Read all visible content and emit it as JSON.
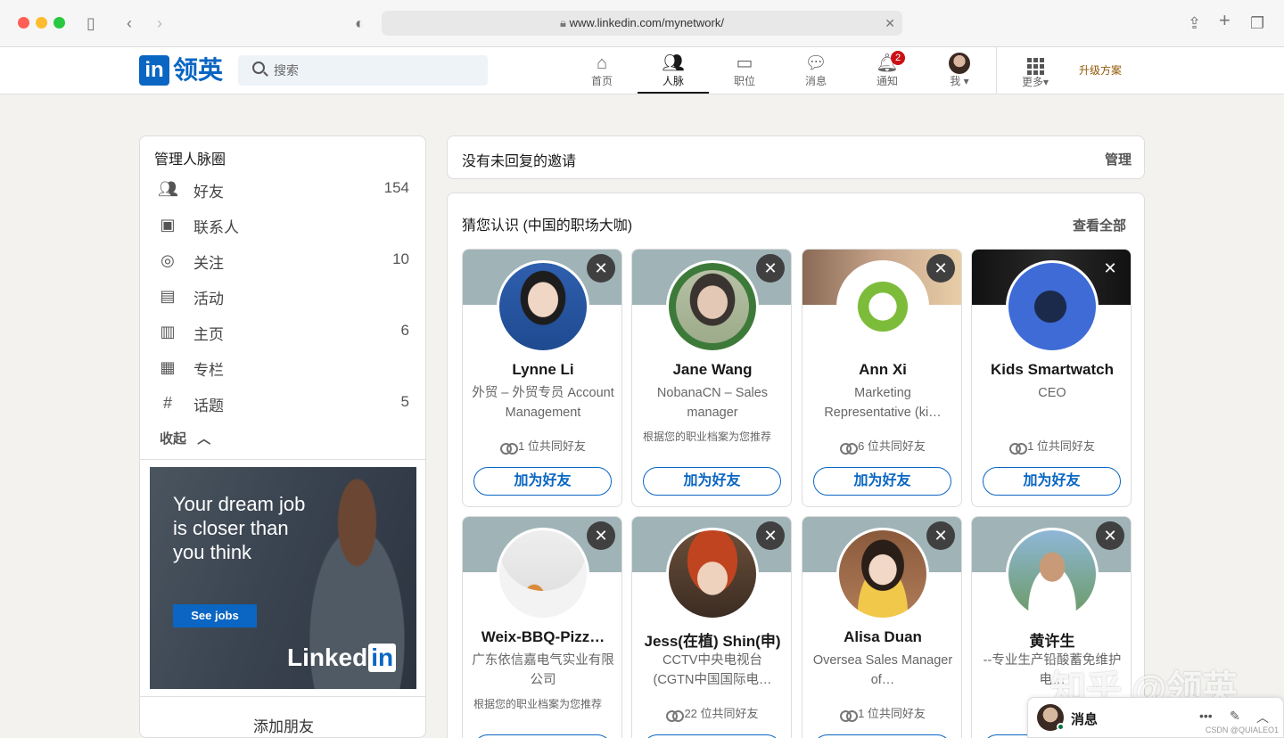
{
  "browser": {
    "url": "www.linkedin.com/mynetwork/"
  },
  "header": {
    "logo_in": "in",
    "logo_cn": "领英",
    "search_placeholder": "搜索",
    "nav": [
      {
        "label": "首页",
        "icon": "home-icon"
      },
      {
        "label": "人脉",
        "icon": "people-icon",
        "active": true
      },
      {
        "label": "职位",
        "icon": "briefcase-icon"
      },
      {
        "label": "消息",
        "icon": "messaging-icon"
      },
      {
        "label": "通知",
        "icon": "bell-icon",
        "badge": "2"
      },
      {
        "label": "我",
        "icon": "avatar"
      },
      {
        "label": "更多",
        "icon": "grid-icon"
      }
    ],
    "upgrade": "升级方案"
  },
  "sidebar": {
    "title": "管理人脉圈",
    "items": [
      {
        "label": "好友",
        "count": "154",
        "icon": "people-icon"
      },
      {
        "label": "联系人",
        "count": "",
        "icon": "contact-book-icon"
      },
      {
        "label": "关注",
        "count": "10",
        "icon": "follow-icon"
      },
      {
        "label": "活动",
        "count": "",
        "icon": "calendar-icon"
      },
      {
        "label": "主页",
        "count": "6",
        "icon": "building-icon"
      },
      {
        "label": "专栏",
        "count": "",
        "icon": "newsletter-icon"
      },
      {
        "label": "话题",
        "count": "5",
        "icon": "hashtag-icon"
      }
    ],
    "collapse": "收起",
    "ad": {
      "text": "Your dream job is closer than you think",
      "button": "See jobs",
      "brand": "Linked",
      "brand_in": "in"
    },
    "add_friends": "添加朋友"
  },
  "invitations": {
    "title": "没有未回复的邀请",
    "manage": "管理"
  },
  "suggestions": {
    "title": "猜您认识 (中国的职场大咖)",
    "see_all": "查看全部",
    "connect_label": "加为好友",
    "people": [
      {
        "name": "Lynne Li",
        "headline": "外贸 – 外贸专员 Account Management",
        "mutual": "1 位共同好友"
      },
      {
        "name": "Jane Wang",
        "headline": "NobanaCN – Sales manager",
        "mutual": "根据您的职业档案为您推荐"
      },
      {
        "name": "Ann Xi",
        "headline": "Marketing Representative (ki…",
        "mutual": "6 位共同好友"
      },
      {
        "name": "Kids Smartwatch",
        "headline": "CEO",
        "mutual": "1 位共同好友"
      },
      {
        "name": "Weix-BBQ-Pizz…",
        "headline": "广东依信嘉电气实业有限公司",
        "mutual": "根据您的职业档案为您推荐"
      },
      {
        "name": "Jess(在植) Shin(申)",
        "headline": "CCTV中央电视台 (CGTN中国国际电…",
        "mutual": "22 位共同好友"
      },
      {
        "name": "Alisa Duan",
        "headline": "Oversea Sales Manager of…",
        "mutual": "1 位共同好友"
      },
      {
        "name": "黄许生",
        "headline": "--专业生产铅酸蓄免维护电…",
        "mutual": ""
      }
    ]
  },
  "messaging": {
    "title": "消息"
  },
  "watermark": "知乎 @领英",
  "csdn": "CSDN @QUIALEO1"
}
